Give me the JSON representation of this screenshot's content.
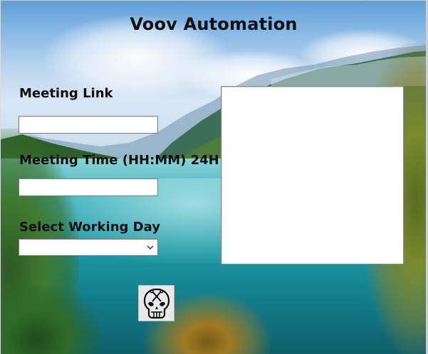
{
  "app": {
    "title": "Voov Automation"
  },
  "form": {
    "meeting_link": {
      "label": "Meeting Link",
      "value": "",
      "placeholder": ""
    },
    "meeting_time": {
      "label": "Meeting Time (HH:MM) 24H",
      "value": "",
      "placeholder": ""
    },
    "working_day": {
      "label": "Select Working Day",
      "selected": "",
      "icon": "chevron-down-icon"
    }
  },
  "output": {
    "text": ""
  },
  "run_button": {
    "icon": "skull-crossbones-icon"
  }
}
